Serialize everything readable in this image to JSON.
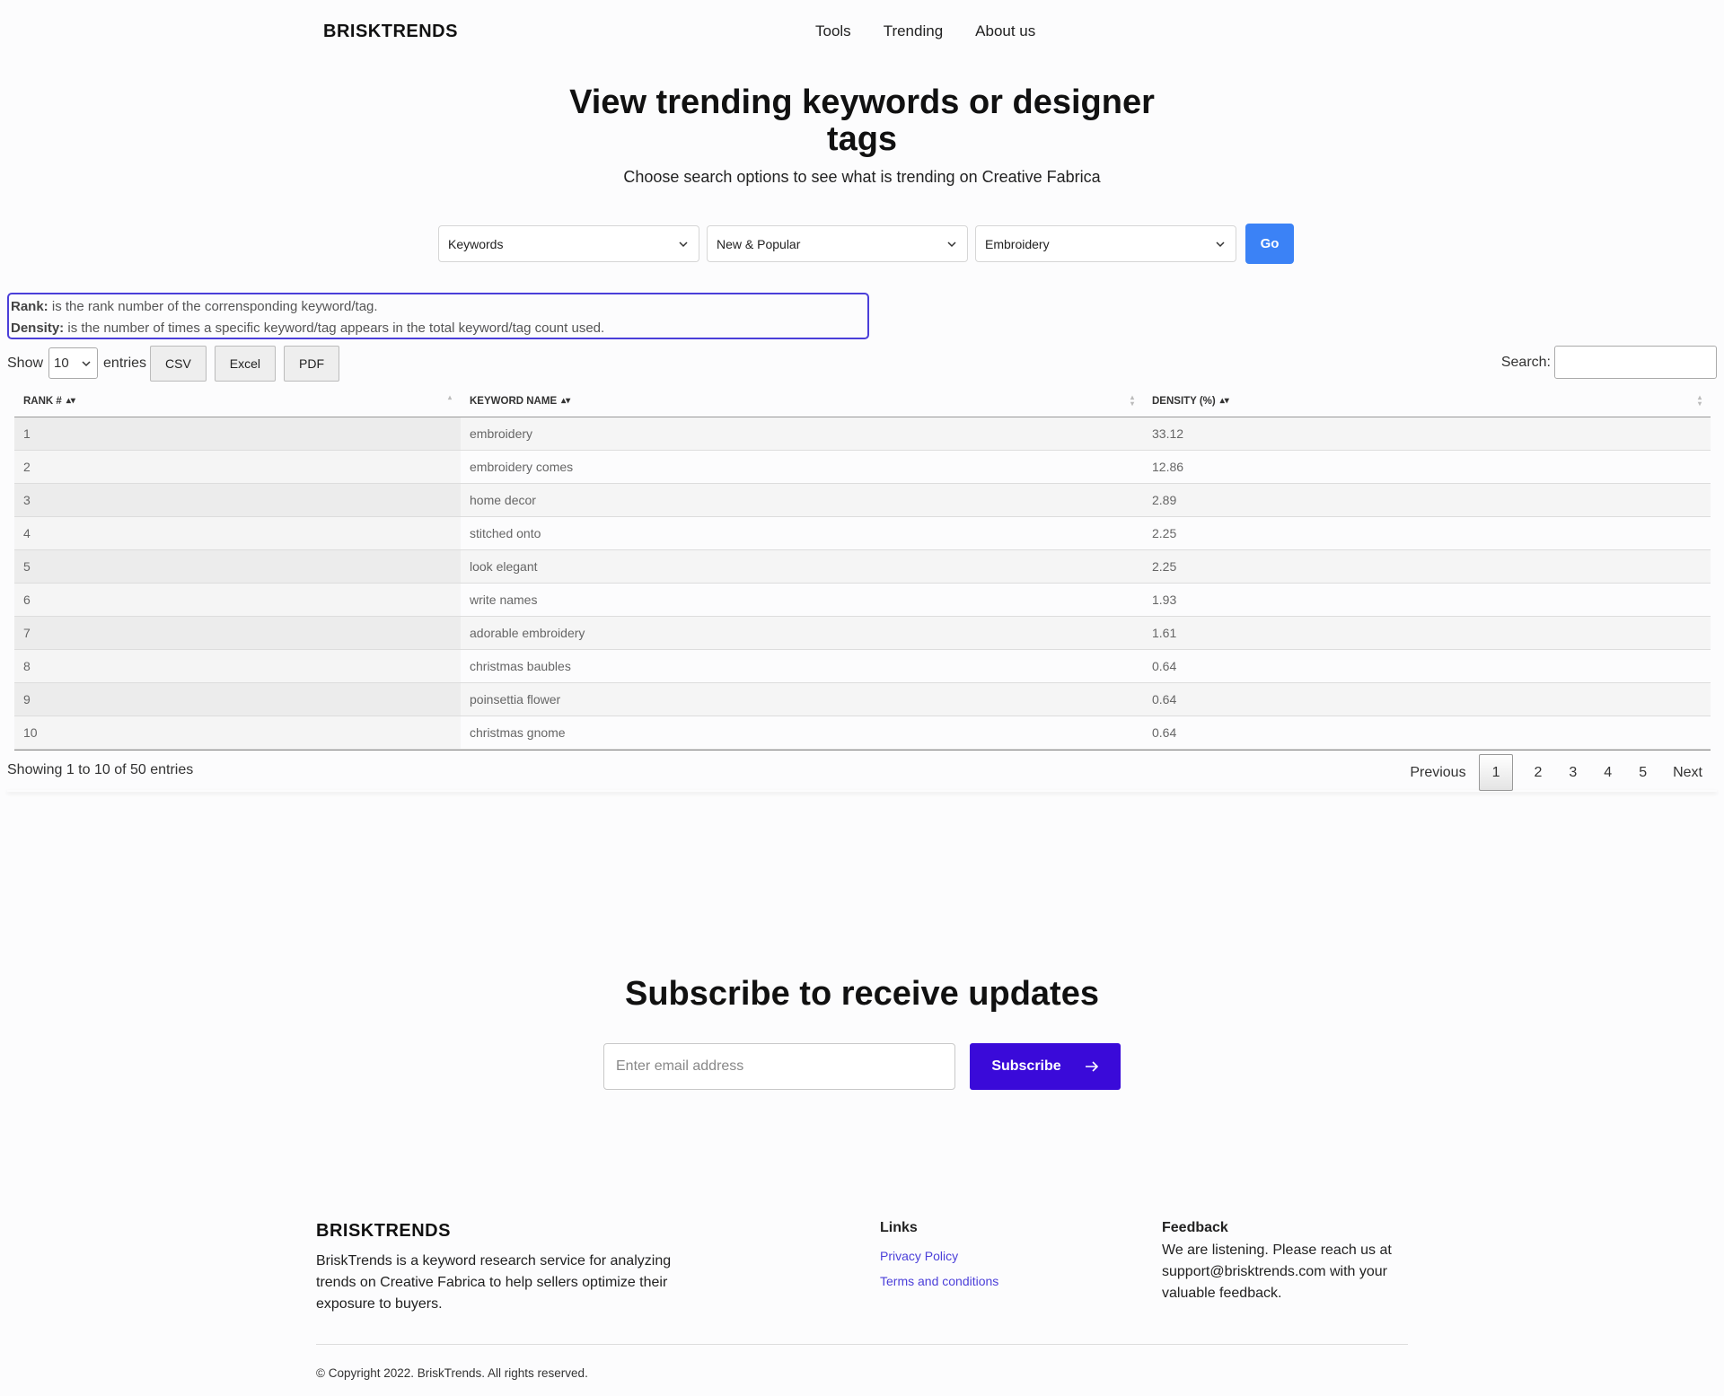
{
  "header": {
    "brand": "BRISKTRENDS",
    "nav": [
      "Tools",
      "Trending",
      "About us"
    ]
  },
  "hero": {
    "title": "View trending keywords or designer tags",
    "subtitle": "Choose search options to see what is trending on Creative Fabrica"
  },
  "filters": {
    "type": "Keywords",
    "sort": "New & Popular",
    "category": "Embroidery",
    "go_label": "Go"
  },
  "legend": {
    "rank_label": "Rank:",
    "rank_text": " is the rank number of the corrensponding keyword/tag.",
    "density_label": "Density:",
    "density_text": " is the number of times a specific keyword/tag appears in the total keyword/tag count used."
  },
  "controls": {
    "show_label": "Show",
    "page_length": "10",
    "entries_label": "entries",
    "export_buttons": [
      "CSV",
      "Excel",
      "PDF"
    ],
    "search_label": "Search:"
  },
  "table": {
    "headers": [
      "RANK #",
      "KEYWORD NAME",
      "DENSITY (%)"
    ],
    "rows": [
      [
        "1",
        "embroidery",
        "33.12"
      ],
      [
        "2",
        "embroidery comes",
        "12.86"
      ],
      [
        "3",
        "home decor",
        "2.89"
      ],
      [
        "4",
        "stitched onto",
        "2.25"
      ],
      [
        "5",
        "look elegant",
        "2.25"
      ],
      [
        "6",
        "write names",
        "1.93"
      ],
      [
        "7",
        "adorable embroidery",
        "1.61"
      ],
      [
        "8",
        "christmas baubles",
        "0.64"
      ],
      [
        "9",
        "poinsettia flower",
        "0.64"
      ],
      [
        "10",
        "christmas gnome",
        "0.64"
      ]
    ],
    "info": "Showing 1 to 10 of 50 entries"
  },
  "pagination": {
    "previous": "Previous",
    "pages": [
      "1",
      "2",
      "3",
      "4",
      "5"
    ],
    "current": "1",
    "next": "Next"
  },
  "subscribe": {
    "title": "Subscribe to receive updates",
    "placeholder": "Enter email address",
    "button": "Subscribe"
  },
  "footer": {
    "brand": "BRISKTRENDS",
    "description": "BriskTrends is a keyword research service for analyzing trends on Creative Fabrica to help sellers optimize their exposure to buyers.",
    "links_title": "Links",
    "links": [
      "Privacy Policy",
      "Terms and conditions"
    ],
    "feedback_title": "Feedback",
    "feedback_text": "We are listening. Please reach us at support@brisktrends.com with your valuable feedback.",
    "copyright": "© Copyright 2022. BriskTrends. All rights reserved."
  },
  "colors": {
    "go_button": "#3b82f6",
    "subscribe_button": "#3a0ad9",
    "legend_border": "#4b3fd9",
    "link": "#4b3fd9"
  },
  "icons": {
    "select_caret": "chevron-down-icon",
    "sort": "sort-icon",
    "subscribe_arrow": "arrow-right-icon"
  }
}
